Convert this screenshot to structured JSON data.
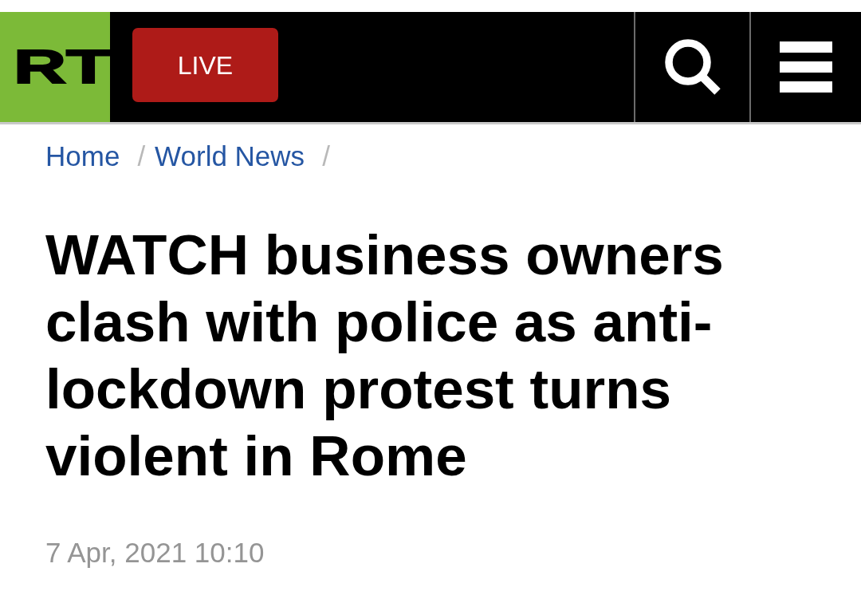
{
  "header": {
    "logo": "RT",
    "live_button": "LIVE"
  },
  "breadcrumb": [
    {
      "label": "Home",
      "separator": "/"
    },
    {
      "label": "World News",
      "separator": "/"
    }
  ],
  "article": {
    "headline": "WATCH business owners clash with police as anti-lockdown protest turns violent in Rome",
    "date": "7 Apr, 2021 10:10"
  }
}
